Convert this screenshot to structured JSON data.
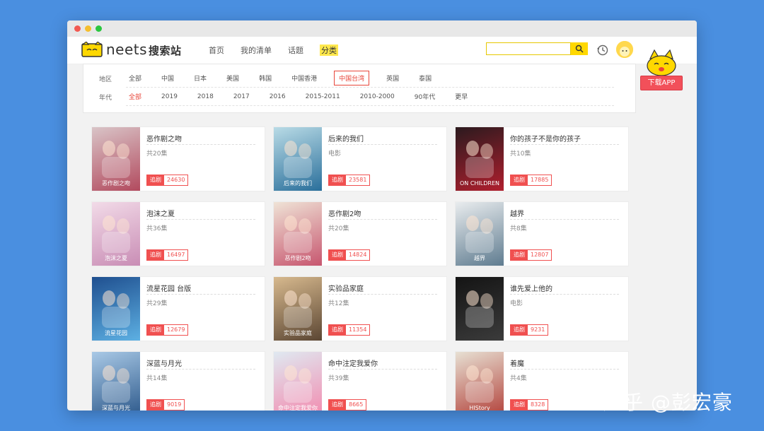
{
  "header": {
    "logo_main": "neets",
    "logo_cn": "搜索站",
    "nav": [
      {
        "label": "首页"
      },
      {
        "label": "我的清单"
      },
      {
        "label": "话题"
      },
      {
        "label": "分类"
      }
    ],
    "search_placeholder": ""
  },
  "filters": {
    "region_label": "地区",
    "regions": [
      "全部",
      "中国",
      "日本",
      "美国",
      "韩国",
      "中国香港",
      "中国台湾",
      "英国",
      "泰国"
    ],
    "selected_region": "中国台湾",
    "year_label": "年代",
    "years": [
      "全部",
      "2019",
      "2018",
      "2017",
      "2016",
      "2015-2011",
      "2010-2000",
      "90年代",
      "更早"
    ],
    "selected_year": "全部"
  },
  "download": {
    "label": "下载APP"
  },
  "follow_label": "追剧",
  "cards": [
    {
      "title": "恶作剧之吻",
      "sub": "共20集",
      "count": "24630",
      "poster_text": "恶作剧之吻",
      "colors": [
        "#d9c4c7",
        "#b24a5e"
      ]
    },
    {
      "title": "后来的我们",
      "sub": "电影",
      "count": "23581",
      "poster_text": "后来的我们",
      "colors": [
        "#b9dbe6",
        "#2a6f9b"
      ]
    },
    {
      "title": "你的孩子不是你的孩子",
      "sub": "共10集",
      "count": "17885",
      "poster_text": "ON CHILDREN",
      "colors": [
        "#2b1a1e",
        "#b01f2e"
      ]
    },
    {
      "title": "泡沫之夏",
      "sub": "共36集",
      "count": "16497",
      "poster_text": "泡沫之夏",
      "colors": [
        "#f2dbe8",
        "#c98db5"
      ]
    },
    {
      "title": "恶作剧2吻",
      "sub": "共20集",
      "count": "14824",
      "poster_text": "恶作剧2吻",
      "colors": [
        "#efe3d6",
        "#c7566f"
      ]
    },
    {
      "title": "越界",
      "sub": "共8集",
      "count": "12807",
      "poster_text": "越界",
      "colors": [
        "#e9ecee",
        "#5f7c90"
      ]
    },
    {
      "title": "流星花园 台版",
      "sub": "共29集",
      "count": "12679",
      "poster_text": "流星花园",
      "colors": [
        "#1f4f8f",
        "#5db0e3"
      ]
    },
    {
      "title": "实验品家庭",
      "sub": "共12集",
      "count": "11354",
      "poster_text": "实验品家庭",
      "colors": [
        "#d7b98e",
        "#5b4633"
      ]
    },
    {
      "title": "谁先爱上他的",
      "sub": "电影",
      "count": "9231",
      "poster_text": "",
      "colors": [
        "#141414",
        "#3b3b3b"
      ]
    },
    {
      "title": "深蓝与月光",
      "sub": "共14集",
      "count": "9019",
      "poster_text": "深蓝与月光",
      "colors": [
        "#a9c9e6",
        "#2e5a8c"
      ]
    },
    {
      "title": "命中注定我爱你",
      "sub": "共39集",
      "count": "8665",
      "poster_text": "命中注定我爱你",
      "colors": [
        "#dfe9f1",
        "#f28cb0"
      ]
    },
    {
      "title": "着魔",
      "sub": "共4集",
      "count": "8328",
      "poster_text": "HIStory",
      "colors": [
        "#e7e0d3",
        "#b3433c"
      ]
    }
  ],
  "watermark": "知乎 @彭宏豪"
}
